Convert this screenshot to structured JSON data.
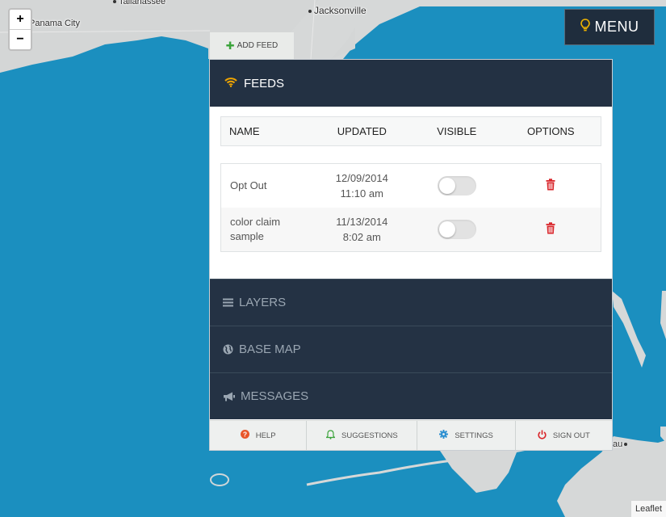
{
  "map": {
    "labels": {
      "tallahassee": "Tallahassee",
      "panama_city": "Panama City",
      "jacksonville": "Jacksonville",
      "nassau_partial": "au"
    },
    "zoom_in": "+",
    "zoom_out": "−",
    "attribution": "Leaflet"
  },
  "menu": {
    "label": "MENU",
    "icon": "lightbulb-icon"
  },
  "add_feed": {
    "label": "ADD FEED",
    "icon": "plus-icon",
    "icon_color": "#3aa33a"
  },
  "feeds": {
    "title": "FEEDS",
    "icon": "wifi-icon",
    "icon_color": "#f0a500",
    "columns": [
      "NAME",
      "UPDATED",
      "VISIBLE",
      "OPTIONS"
    ],
    "rows": [
      {
        "name": "Opt Out",
        "date": "12/09/2014",
        "time": "11:10 am",
        "visible": false
      },
      {
        "name": "color claim sample",
        "date": "11/13/2014",
        "time": "8:02 am",
        "visible": false
      }
    ]
  },
  "sections": [
    {
      "label": "LAYERS",
      "icon": "list-icon"
    },
    {
      "label": "BASE MAP",
      "icon": "globe-icon"
    },
    {
      "label": "MESSAGES",
      "icon": "megaphone-icon"
    }
  ],
  "footer": {
    "help": "HELP",
    "suggestions": "SUGGESTIONS",
    "settings": "SETTINGS",
    "sign_out": "SIGN OUT"
  },
  "colors": {
    "water": "#1b8fbf",
    "land": "#d9d9d9",
    "panel_header": "#233143",
    "trash": "#d9262b",
    "help_icon": "#e8562a",
    "suggestions_icon": "#3aa33a",
    "settings_icon": "#2c8fd0",
    "sign_out_icon": "#d9262b"
  }
}
